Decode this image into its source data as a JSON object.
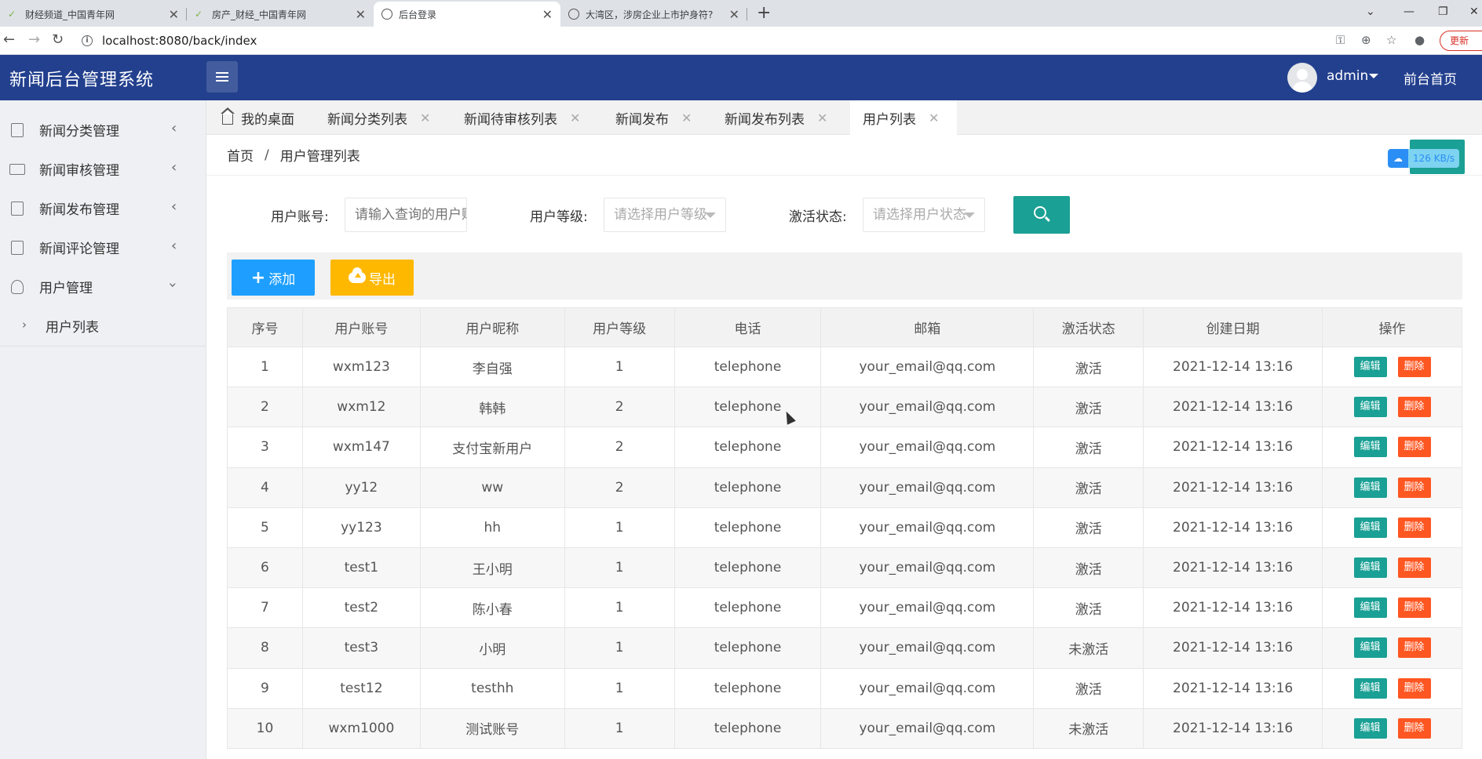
{
  "browser": {
    "tabs": [
      {
        "title": "财经频道_中国青年网",
        "active": false
      },
      {
        "title": "房产_财经_中国青年网",
        "active": false
      },
      {
        "title": "后台登录",
        "active": true
      },
      {
        "title": "大湾区，涉房企业上市护身符?",
        "active": false
      }
    ],
    "new_tab": "+",
    "url": "localhost:8080/back/index",
    "update_label": "更新"
  },
  "header": {
    "title": "新闻后台管理系统",
    "user": "admin",
    "front_link": "前台首页"
  },
  "sidebar": {
    "items": [
      {
        "label": "新闻分类管理",
        "icon": "document-icon"
      },
      {
        "label": "新闻审核管理",
        "icon": "list-icon"
      },
      {
        "label": "新闻发布管理",
        "icon": "publish-icon"
      },
      {
        "label": "新闻评论管理",
        "icon": "comment-icon"
      },
      {
        "label": "用户管理",
        "icon": "user-icon"
      }
    ],
    "sub_items": [
      {
        "label": "用户列表"
      }
    ]
  },
  "page_tabs": [
    {
      "label": "我的桌面",
      "closable": false
    },
    {
      "label": "新闻分类列表",
      "closable": true
    },
    {
      "label": "新闻待审核列表",
      "closable": true
    },
    {
      "label": "新闻发布",
      "closable": true
    },
    {
      "label": "新闻发布列表",
      "closable": true
    },
    {
      "label": "用户列表",
      "closable": true,
      "active": true
    }
  ],
  "breadcrumb": {
    "home": "首页",
    "current": "用户管理列表"
  },
  "speed": "126 KB/s",
  "search": {
    "account_label": "用户账号:",
    "account_placeholder": "请输入查询的用户账号",
    "level_label": "用户等级:",
    "level_placeholder": "请选择用户等级",
    "status_label": "激活状态:",
    "status_placeholder": "请选择用户状态"
  },
  "toolbar": {
    "add_label": "添加",
    "export_label": "导出"
  },
  "table": {
    "columns": [
      "序号",
      "用户账号",
      "用户昵称",
      "用户等级",
      "电话",
      "邮箱",
      "激活状态",
      "创建日期",
      "操作"
    ],
    "edit_label": "编辑",
    "delete_label": "删除",
    "rows": [
      {
        "no": "1",
        "account": "wxm123",
        "nick": "李自强",
        "level": "1",
        "phone": "telephone",
        "email": "your_email@qq.com",
        "status": "激活",
        "date": "2021-12-14 13:16"
      },
      {
        "no": "2",
        "account": "wxm12",
        "nick": "韩韩",
        "level": "2",
        "phone": "telephone",
        "email": "your_email@qq.com",
        "status": "激活",
        "date": "2021-12-14 13:16"
      },
      {
        "no": "3",
        "account": "wxm147",
        "nick": "支付宝新用户",
        "level": "2",
        "phone": "telephone",
        "email": "your_email@qq.com",
        "status": "激活",
        "date": "2021-12-14 13:16"
      },
      {
        "no": "4",
        "account": "yy12",
        "nick": "ww",
        "level": "2",
        "phone": "telephone",
        "email": "your_email@qq.com",
        "status": "激活",
        "date": "2021-12-14 13:16"
      },
      {
        "no": "5",
        "account": "yy123",
        "nick": "hh",
        "level": "1",
        "phone": "telephone",
        "email": "your_email@qq.com",
        "status": "激活",
        "date": "2021-12-14 13:16"
      },
      {
        "no": "6",
        "account": "test1",
        "nick": "王小明",
        "level": "1",
        "phone": "telephone",
        "email": "your_email@qq.com",
        "status": "激活",
        "date": "2021-12-14 13:16"
      },
      {
        "no": "7",
        "account": "test2",
        "nick": "陈小春",
        "level": "1",
        "phone": "telephone",
        "email": "your_email@qq.com",
        "status": "激活",
        "date": "2021-12-14 13:16"
      },
      {
        "no": "8",
        "account": "test3",
        "nick": "小明",
        "level": "1",
        "phone": "telephone",
        "email": "your_email@qq.com",
        "status": "未激活",
        "date": "2021-12-14 13:16"
      },
      {
        "no": "9",
        "account": "test12",
        "nick": "testhh",
        "level": "1",
        "phone": "telephone",
        "email": "your_email@qq.com",
        "status": "激活",
        "date": "2021-12-14 13:16"
      },
      {
        "no": "10",
        "account": "wxm1000",
        "nick": "测试账号",
        "level": "1",
        "phone": "telephone",
        "email": "your_email@qq.com",
        "status": "未激活",
        "date": "2021-12-14 13:16"
      }
    ]
  }
}
